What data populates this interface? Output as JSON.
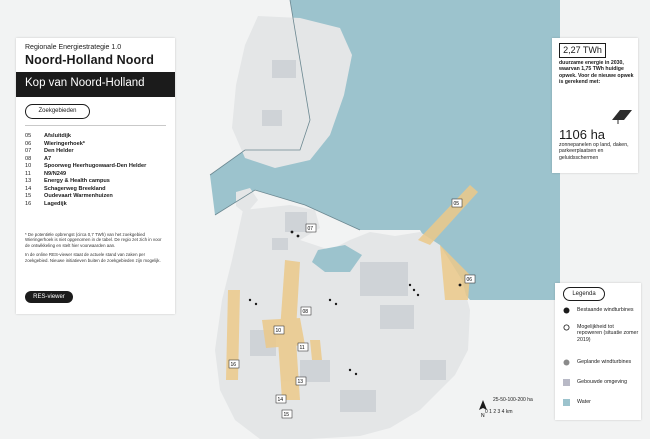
{
  "panel": {
    "subtitle": "Regionale Energiestrategie 1.0",
    "title": "Noord-Holland Noord",
    "region": "Kop van Noord-Holland",
    "tab_label": "Zoekgebieden"
  },
  "areas": [
    {
      "num": "05",
      "name": "Afsluitdijk"
    },
    {
      "num": "06",
      "name": "Wieringerhoek*"
    },
    {
      "num": "07",
      "name": "Den Helder"
    },
    {
      "num": "08",
      "name": "A7"
    },
    {
      "num": "10",
      "name": "Spoorweg Heerhugowaard-Den Helder"
    },
    {
      "num": "11",
      "name": "N9/N249"
    },
    {
      "num": "13",
      "name": "Energy & Health campus"
    },
    {
      "num": "14",
      "name": "Schagerweg Breekland"
    },
    {
      "num": "15",
      "name": "Oudevaart Warmenhuizen"
    },
    {
      "num": "16",
      "name": "Lagedijk"
    }
  ],
  "footnote": {
    "p1": "* De potentiële opbrengst (circa 0,7 TWh) van het zoekgebied Wieringerhoek is niet opgenomen in de tabel. De regio zet zich in voor de ontwikkeling en stelt hier voorwaarden aan.",
    "p2": "In de online RES-viewer staat de actuele stand van zaken per zoekgebied. Nieuwe initiatieven buiten de zoekgebieden zijn mogelijk."
  },
  "res_button": "RES-viewer",
  "energy": {
    "value": "2,27 TWh",
    "text": "duurzame energie in 2030, waarvan 1,75 TWh huidige opwek. Voor de nieuwe opwek is gerekend met:",
    "ha_value": "1106 ha",
    "ha_text": "zonnepanelen op land, daken, parkeerplaatsen en geluidsschermen"
  },
  "legend": {
    "title": "Legenda",
    "items": [
      {
        "label": "Bestaande windturbines"
      },
      {
        "label": "Mogelijkheid tot repoweren (situatie zomer 2019)"
      },
      {
        "label": "Geplande windturbines"
      },
      {
        "label": "Gebouwde omgeving"
      },
      {
        "label": "Water"
      }
    ]
  },
  "scale_label": "0 1 2 3 4 km",
  "scale_ticks": "25-50-100-200 ha",
  "map_labels": {
    "l05": "05",
    "l06": "06",
    "l07": "07",
    "l08": "08",
    "l10": "10",
    "l11": "11",
    "l13": "13",
    "l14": "14",
    "l15": "15",
    "l16": "16"
  },
  "colors": {
    "water": "#9cc3cd",
    "land": "#e4e6e7",
    "built": "#cfd3d7",
    "search_area": "#ecc98a",
    "dark": "#1b1b1b"
  }
}
